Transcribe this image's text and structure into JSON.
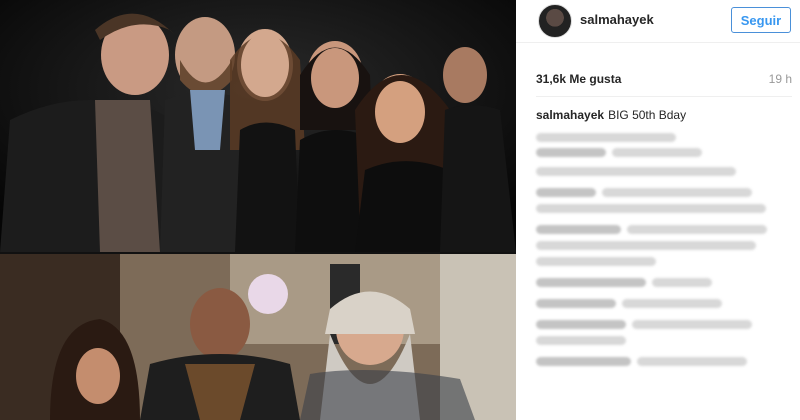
{
  "post": {
    "username": "salmahayek",
    "follow_label": "Seguir",
    "likes": "31,6k Me gusta",
    "time": "19 h",
    "caption_user": "salmahayek",
    "caption_text": "BIG 50th Bday"
  },
  "colors": {
    "accent": "#3897f0",
    "text": "#262626",
    "muted": "#999999"
  },
  "icons": {
    "avatar": "profile-picture"
  }
}
